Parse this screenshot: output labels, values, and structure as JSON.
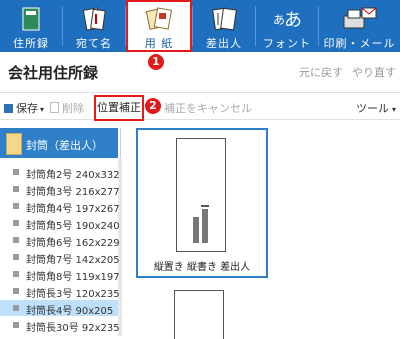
{
  "ribbon": {
    "tabs": [
      {
        "label": "住所録"
      },
      {
        "label": "宛て名"
      },
      {
        "label": "用 紙"
      },
      {
        "label": "差出人"
      },
      {
        "label": "フォント"
      },
      {
        "label": "印刷・メール"
      }
    ],
    "colors": {
      "ribbon_bg": "#1f6fbf",
      "highlight": "#e11a1a"
    }
  },
  "callouts": [
    "1",
    "2"
  ],
  "page": {
    "title": "会社用住所録",
    "undo": "元に戻す",
    "redo": "やり直す"
  },
  "toolbar": {
    "save": "保存",
    "delete": "削除",
    "position_adjust": "位置補正",
    "cancel_adjust": "補正をキャンセル",
    "tools": "ツール"
  },
  "paper_list": {
    "category": "封筒（差出人）",
    "items": [
      "封筒角2号 240x332",
      "封筒角3号 216x277",
      "封筒角4号 197x267",
      "封筒角5号 190x240",
      "封筒角6号 162x229",
      "封筒角7号 142x205",
      "封筒角8号 119x197",
      "封筒長3号 120x235",
      "封筒長4号  90x205",
      "封筒長30号 92x235"
    ],
    "selected_index": 8
  },
  "preview": {
    "caption": "縦置き 縦書き 差出人"
  }
}
